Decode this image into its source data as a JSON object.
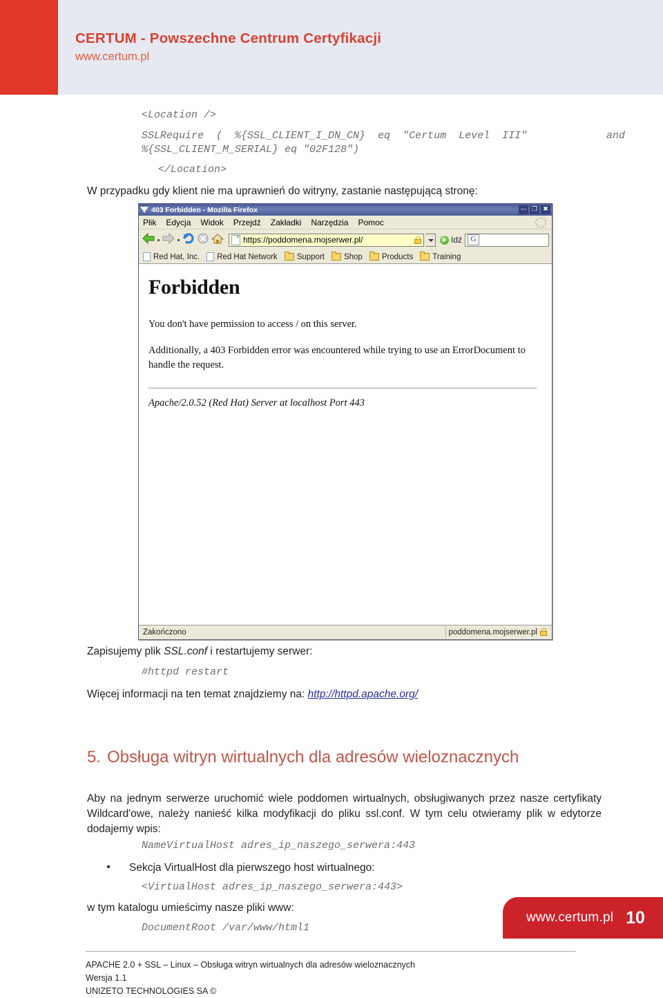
{
  "header": {
    "brand": "CERTUM - Powszechne Centrum Certyfikacji",
    "url": "www.certum.pl",
    "brand_color": "#d8412f",
    "block_color": "#e0372a",
    "band_color": "#e6e9f2"
  },
  "top_code": {
    "line1": "<Location />",
    "line2a": "SSLRequire  (  %{SSL_CLIENT_I_DN_CN}  eq  \"Certum  Level  III\"",
    "line2b": "and",
    "line3": "%{SSL_CLIENT_M_SERIAL} eq \"02F128\")",
    "line4": "</Location>"
  },
  "intro_line": "W przypadku gdy klient nie ma uprawnień do witryny, zastanie następującą stronę:",
  "browser": {
    "title": "403 Forbidden - Mozilla Firefox",
    "minimize_label": "—",
    "restore_label": "❐",
    "close_label": "✖",
    "menus": [
      "Plik",
      "Edycja",
      "Widok",
      "Przejdź",
      "Zakładki",
      "Narzędzia",
      "Pomoc"
    ],
    "url": "https://poddomena.mojserwer.pl/",
    "go_label": "Idź",
    "search_placeholder": "",
    "search_value": "",
    "search_engine_glyph": "G",
    "bookmarks": [
      {
        "label": "Red Hat, Inc.",
        "icon": "page-icon"
      },
      {
        "label": "Red Hat Network",
        "icon": "page-icon"
      },
      {
        "label": "Support",
        "icon": "folder-icon"
      },
      {
        "label": "Shop",
        "icon": "folder-icon"
      },
      {
        "label": "Products",
        "icon": "folder-icon"
      },
      {
        "label": "Training",
        "icon": "folder-icon"
      }
    ],
    "page": {
      "heading": "Forbidden",
      "p1": "You don't have permission to access / on this server.",
      "p2": "Additionally, a 403 Forbidden error was encountered while trying to use an ErrorDocument to handle the request.",
      "signature": "Apache/2.0.52 (Red Hat) Server at localhost Port 443"
    },
    "status_left": "Zakończono",
    "status_right": "poddomena.mojserwer.pl"
  },
  "save_text": {
    "prefix": "Zapisujemy plik ",
    "file": "SSL.conf",
    "suffix": " i restartujemy serwer:"
  },
  "code_httpd": "#httpd restart",
  "more_info": {
    "prefix": "Więcej informacji na ten temat znajdziemy na: ",
    "link": "http://httpd.apache.org/"
  },
  "section": {
    "number": "5.",
    "title": "Obsługa witryn wirtualnych dla adresów wieloznacznych",
    "color": "#c0564a"
  },
  "body_paragraph": "Aby na jednym serwerze uruchomić wiele poddomen wirtualnych, obsługiwanych przez nasze certyfikaty Wildcard'owe, należy nanieść kilka modyfikacji do pliku ssl.conf. W tym celu otwieramy plik w edytorze dodajemy wpis:",
  "code_namevirtualhost": "NameVirtualHost adres_ip_naszego_serwera:443",
  "bullet_virtualhost": "Sekcja VirtualHost dla pierwszego host wirtualnego:",
  "code_virtualhost": "<VirtualHost adres_ip_naszego_serwera:443>",
  "katalog_text": "w tym katalogu umieścimy nasze pliki www:",
  "code_documentroot": "DocumentRoot /var/www/html1",
  "footer": {
    "line1": "APACHE 2.0 + SSL – Linux  – Obsługa witryn wirtualnych dla adresów wieloznacznych",
    "line2": "Wersja 1.1",
    "line3": "UNIZETO TECHNOLOGIES SA ©",
    "badge_url": "www.certum.pl",
    "badge_page": "10",
    "badge_color": "#cc2229"
  }
}
